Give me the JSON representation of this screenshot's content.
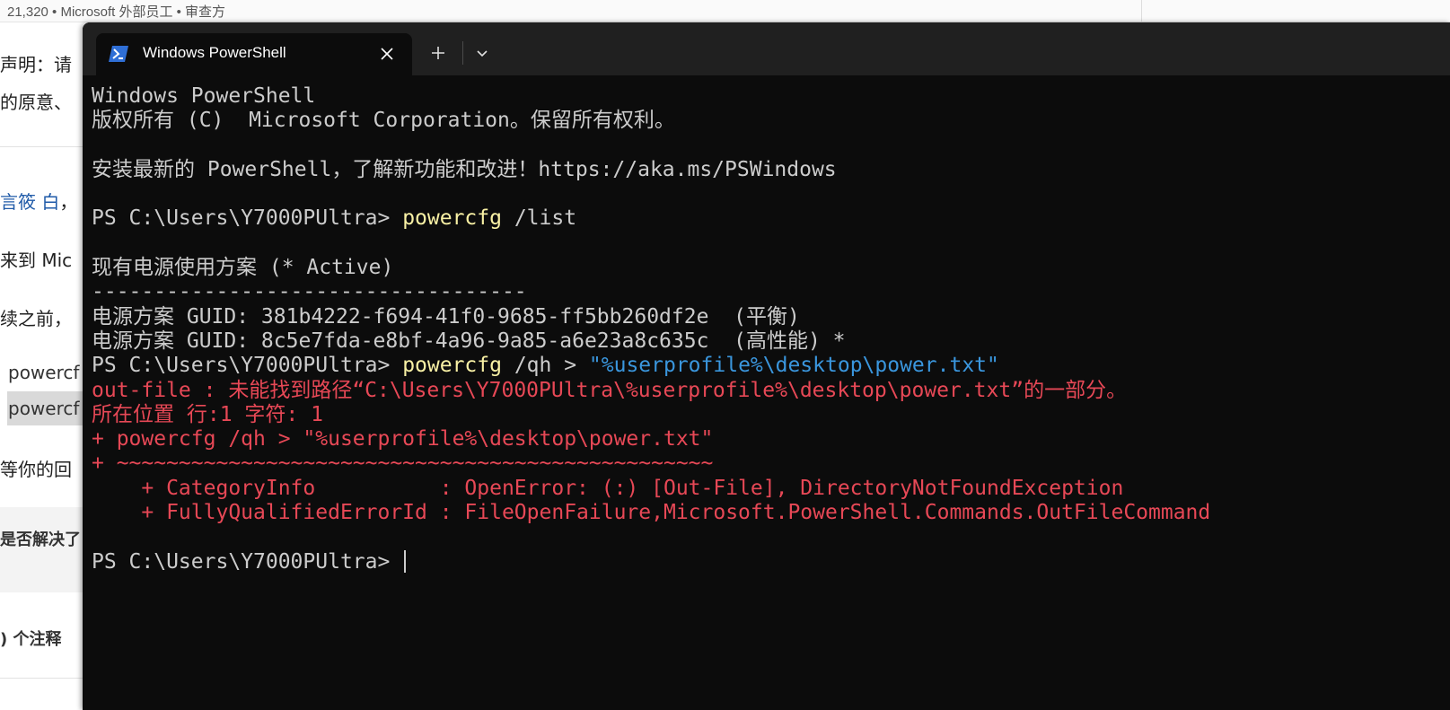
{
  "background_page": {
    "meta_line": "21,320 • Microsoft 外部员工 • 审查方",
    "fragments": [
      {
        "text": "声明：请"
      },
      {
        "text": "的原意、"
      },
      {
        "link_a": "言筱",
        "link_b": "白",
        "tail": "，"
      },
      {
        "text": "来到 Mic"
      },
      {
        "text": "续之前，"
      },
      {
        "code": "powercf"
      },
      {
        "code": "powercf"
      },
      {
        "text": "等你的回"
      },
      {
        "text": "是否解决了"
      },
      {
        "text": ") 个注释"
      }
    ]
  },
  "terminal": {
    "tab_title": "Windows PowerShell",
    "icons": {
      "tab": "powershell-icon",
      "close": "close-icon",
      "new_tab": "plus-icon",
      "dropdown": "chevron-down-icon"
    },
    "colors": {
      "background": "#0c0c0c",
      "text": "#cccccc",
      "command": "#f9f1a5",
      "string": "#3a96dd",
      "error": "#e74856"
    },
    "lines": {
      "l1": "Windows PowerShell",
      "l2": "版权所有 (C)  Microsoft Corporation。保留所有权利。",
      "l3": "",
      "l4": "安装最新的 PowerShell，了解新功能和改进！https://aka.ms/PSWindows",
      "l5": "",
      "l6_prompt": "PS C:\\Users\\Y7000PUltra> ",
      "l6_cmd": "powercfg",
      "l6_args": " /list",
      "l7": "",
      "l8": "现有电源使用方案 (* Active)",
      "l9": "-----------------------------------",
      "l10": "电源方案 GUID: 381b4222-f694-41f0-9685-ff5bb260df2e  (平衡)",
      "l11": "电源方案 GUID: 8c5e7fda-e8bf-4a96-9a85-a6e23a8c635c  (高性能) *",
      "l12_prompt": "PS C:\\Users\\Y7000PUltra> ",
      "l12_cmd": "powercfg",
      "l12_args": " /qh > ",
      "l12_str": "\"%userprofile%\\desktop\\power.txt\"",
      "e1": "out-file : 未能找到路径“C:\\Users\\Y7000PUltra\\%userprofile%\\desktop\\power.txt”的一部分。",
      "e2": "所在位置 行:1 字符: 1",
      "e3": "+ powercfg /qh > \"%userprofile%\\desktop\\power.txt\"",
      "e4": "+ ~~~~~~~~~~~~~~~~~~~~~~~~~~~~~~~~~~~~~~~~~~~~~~~~",
      "e5": "    + CategoryInfo          : OpenError: (:) [Out-File], DirectoryNotFoundException",
      "e6": "    + FullyQualifiedErrorId : FileOpenFailure,Microsoft.PowerShell.Commands.OutFileCommand",
      "l13": "",
      "l14_prompt": "PS C:\\Users\\Y7000PUltra> "
    }
  }
}
